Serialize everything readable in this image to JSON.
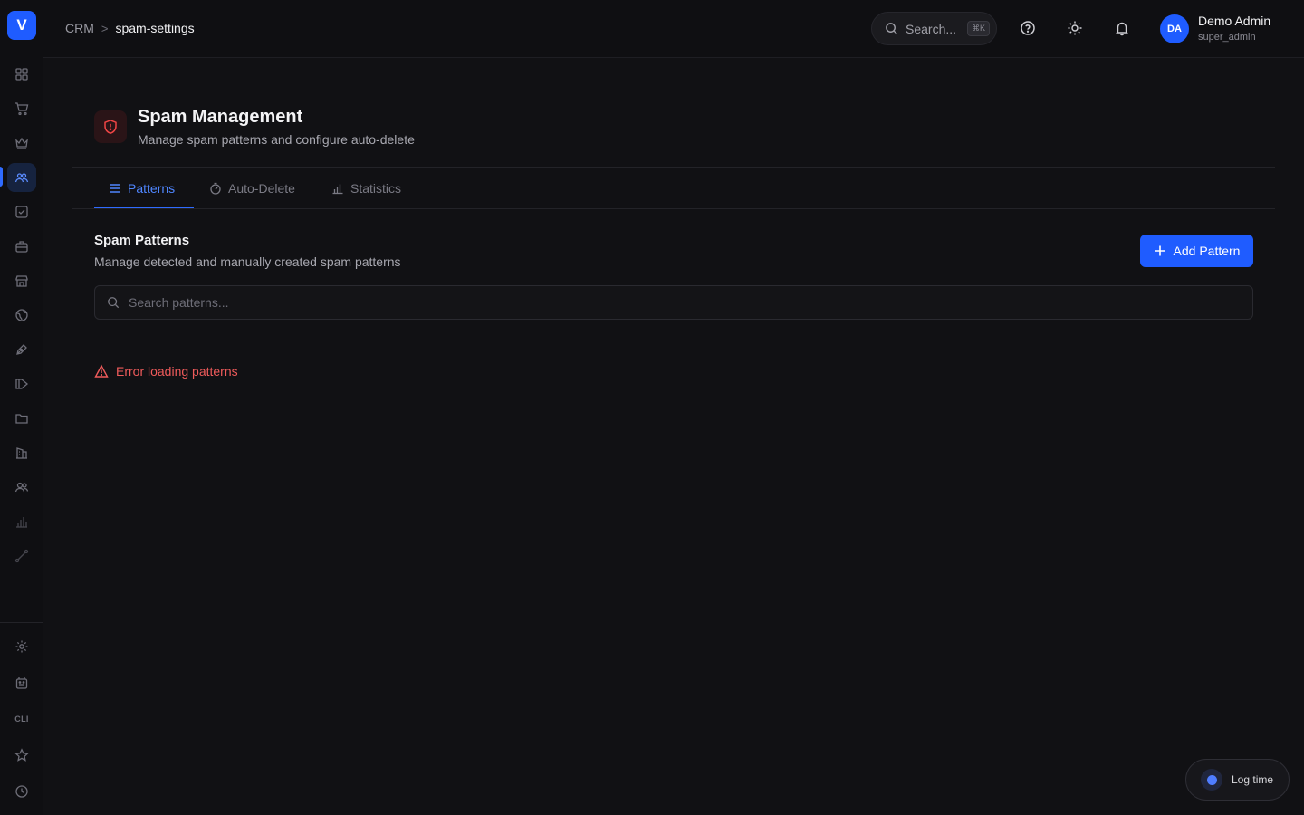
{
  "sidebar": {
    "logo_letter": "V",
    "items": [
      {
        "name": "dashboard",
        "icon": "grid-icon"
      },
      {
        "name": "cart",
        "icon": "cart-icon"
      },
      {
        "name": "crown",
        "icon": "crown-icon"
      },
      {
        "name": "crm",
        "icon": "users-icon",
        "active": true
      },
      {
        "name": "tasks",
        "icon": "checkbox-icon"
      },
      {
        "name": "briefcase",
        "icon": "briefcase-icon"
      },
      {
        "name": "store",
        "icon": "store-icon"
      },
      {
        "name": "globe",
        "icon": "globe-icon"
      },
      {
        "name": "pen",
        "icon": "pen-icon"
      },
      {
        "name": "campaign",
        "icon": "megaphone-icon"
      },
      {
        "name": "folder",
        "icon": "folder-icon"
      },
      {
        "name": "building",
        "icon": "building-icon"
      },
      {
        "name": "team",
        "icon": "team-icon"
      },
      {
        "name": "analytics",
        "icon": "bar-chart-icon"
      },
      {
        "name": "integrations",
        "icon": "route-icon"
      }
    ],
    "bottom_items": [
      {
        "name": "settings",
        "icon": "gear-icon"
      },
      {
        "name": "bot",
        "icon": "robot-icon"
      },
      {
        "name": "cli",
        "label": "CLI"
      },
      {
        "name": "favorites",
        "icon": "star-icon"
      },
      {
        "name": "history",
        "icon": "clock-icon"
      }
    ]
  },
  "header": {
    "breadcrumb": {
      "root": "CRM",
      "separator": ">",
      "current": "spam-settings"
    },
    "search": {
      "placeholder": "Search...",
      "shortcut": "⌘K"
    },
    "user": {
      "initials": "DA",
      "name": "Demo Admin",
      "role": "super_admin"
    }
  },
  "page": {
    "title": "Spam Management",
    "subtitle": "Manage spam patterns and configure auto-delete",
    "accent_color": "#f04545"
  },
  "tabs": [
    {
      "label": "Patterns",
      "icon": "list-icon",
      "active": true
    },
    {
      "label": "Auto-Delete",
      "icon": "timer-icon",
      "active": false
    },
    {
      "label": "Statistics",
      "icon": "bar-chart-icon",
      "active": false
    }
  ],
  "section": {
    "title": "Spam Patterns",
    "subtitle": "Manage detected and manually created spam patterns",
    "add_button": "Add Pattern",
    "search_placeholder": "Search patterns...",
    "error": "Error loading patterns"
  },
  "floating": {
    "log_time": "Log time"
  },
  "colors": {
    "primary": "#1f5cff",
    "error": "#ef5b5b",
    "background": "#111114"
  }
}
